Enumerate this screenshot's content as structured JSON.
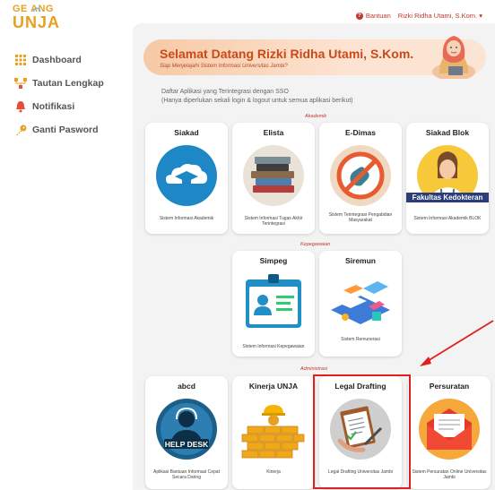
{
  "logo": {
    "top": "GE  ANG",
    "bottom": "UNJA"
  },
  "sidebar": {
    "items": [
      {
        "label": "Dashboard",
        "icon": "grid-icon",
        "color": "#e8a020"
      },
      {
        "label": "Tautan Lengkap",
        "icon": "sitemap-icon",
        "color": "#e8a020"
      },
      {
        "label": "Notifikasi",
        "icon": "bell-icon",
        "color": "#e74c3c"
      },
      {
        "label": "Ganti Pasword",
        "icon": "key-icon",
        "color": "#e8a020"
      }
    ]
  },
  "topbar": {
    "help": "Bantuan",
    "user": "Rizki Ridha Utami, S.Kom."
  },
  "banner": {
    "title": "Selamat Datang Rizki Ridha Utami, S.Kom.",
    "subtitle": "Siap Menjelajahi Sistem Informasi Universitas Jambi?"
  },
  "intro": {
    "line1": "Daftar Aplikasi yang Terintegrasi dengan SSO",
    "line2": "(Hanya diperlukan sekali login & logout untuk semua aplikasi berikut)"
  },
  "sections": {
    "akademik": "Akademik",
    "kepegawaian": "Kepegawaian",
    "administrasi": "Administrasi"
  },
  "apps": [
    {
      "title": "Siakad",
      "desc": "Sistem Informasi Akademik",
      "icon": "graduation-cap-cloud-icon"
    },
    {
      "title": "Elista",
      "desc": "Sistem Informasi Tugas Akhir Terintegrasi",
      "icon": "book-stack-icon"
    },
    {
      "title": "E-Dimas",
      "desc": "Sistem Terintegrasi Pengabdian Masyarakat",
      "icon": "no-hand-icon"
    },
    {
      "title": "Siakad Blok",
      "desc": "Sistem Informasi Akademik BLOK",
      "icon": "doctor-icon",
      "overlay": "Fakultas Kedokteran"
    },
    {
      "title": "Simpeg",
      "desc": "Sistem Informasi Kepegawaian",
      "icon": "id-card-icon"
    },
    {
      "title": "Siremun",
      "desc": "Sistem Remunerasi",
      "icon": "isometric-app-icon"
    },
    {
      "title": "abcd",
      "desc": "Aplikasi Bantuan Informasi Cepat Secara Daring",
      "icon": "help-desk-icon",
      "overlay": "HELP DESK"
    },
    {
      "title": "Kinerja UNJA",
      "desc": "Kinerja",
      "icon": "builder-wall-icon"
    },
    {
      "title": "Legal Drafting",
      "desc": "Legal Drafting Universitas Jambi",
      "icon": "clipboard-pen-icon"
    },
    {
      "title": "Persuratan",
      "desc": "Sistem Persuratan Online Universitas Jambi",
      "icon": "envelope-icon"
    }
  ]
}
